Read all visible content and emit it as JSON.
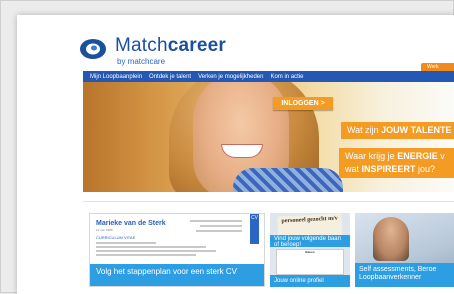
{
  "logo": {
    "brand_part1": "Match",
    "brand_part2": "career",
    "tagline": "by matchcare"
  },
  "corner_tab": "Werk",
  "nav": {
    "items": [
      "Mijn Loopbaanplein",
      "Ontdek je talent",
      "Verken je mogelijkheden",
      "Kom in actie"
    ]
  },
  "hero": {
    "login_button": "INLOGGEN >",
    "banner1_plain": "Wat zijn ",
    "banner1_bold": "JOUW TALENTE",
    "banner2_line1_plain": "Waar krijg je ",
    "banner2_line1_bold": "ENERGIE",
    "banner2_line1_end": " v",
    "banner2_line2_plain": "wat ",
    "banner2_line2_bold": "INSPIREERT",
    "banner2_line2_end": " jou?"
  },
  "cards": {
    "cv": {
      "name": "Marieke van de Sterk",
      "date": "12 mei 1988",
      "subheading": "CURRICULUM VITAE",
      "ribbon": "CV",
      "caption": "Volg het stappenplan voor een sterk CV"
    },
    "vacancy": {
      "note": "personeel gezocht m/v",
      "caption_top": "Vind jouw volgende baan of beroep!",
      "news_header": "Banen",
      "caption_bottom": "Jouw online profiel"
    },
    "assessment": {
      "caption_line1": "Self assessments, Beroe",
      "caption_line2": "Loopbaanverkenner"
    }
  },
  "colors": {
    "brand_blue": "#2458b3",
    "accent_orange": "#f39b22",
    "card_blue": "#2e9ee2"
  }
}
